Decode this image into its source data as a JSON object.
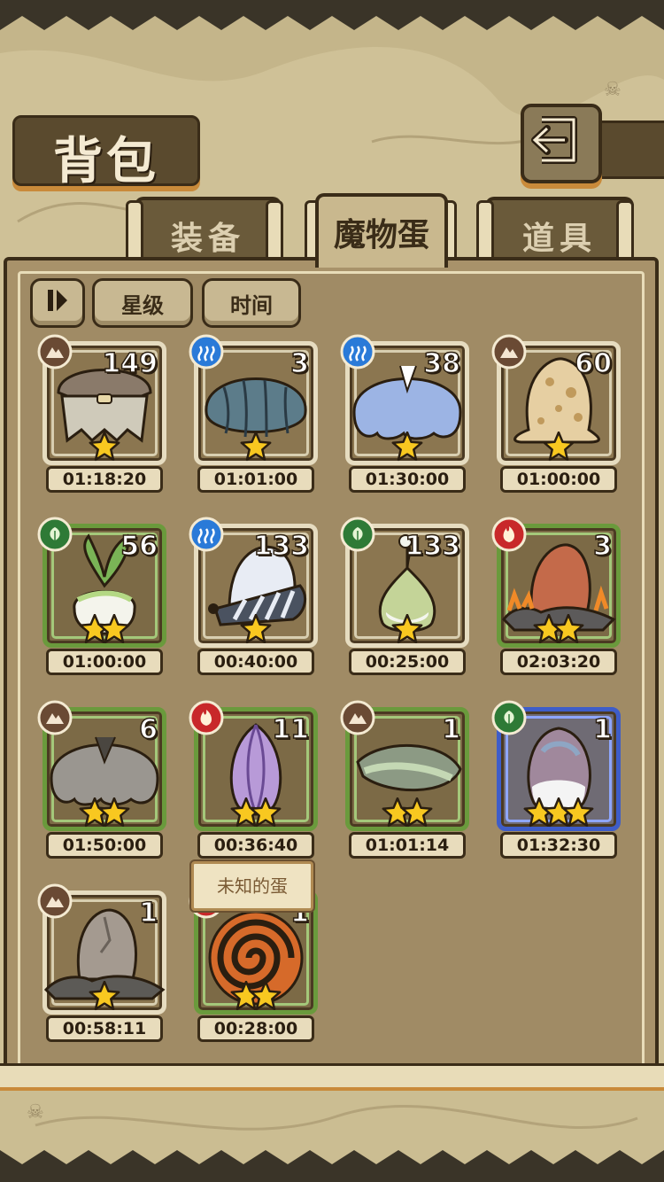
{
  "header": {
    "title": "背包",
    "back_icon": "return-arrow-icon"
  },
  "tabs": [
    {
      "label": "装备",
      "active": false
    },
    {
      "label": "魔物蛋",
      "active": true
    },
    {
      "label": "道具",
      "active": false
    }
  ],
  "sort": {
    "toggle_icon": "sort-toggle-icon",
    "star_label": "星级",
    "time_label": "时间"
  },
  "eggs": [
    {
      "count": "149",
      "element": "earth",
      "stars": 1,
      "time": "01:18:20",
      "frame": "beige",
      "art": "metal-clam"
    },
    {
      "count": "3",
      "element": "water",
      "stars": 1,
      "time": "01:01:00",
      "frame": "beige",
      "art": "blue-shell"
    },
    {
      "count": "38",
      "element": "water",
      "stars": 1,
      "time": "01:30:00",
      "frame": "beige",
      "art": "blue-blob"
    },
    {
      "count": "60",
      "element": "earth",
      "stars": 1,
      "time": "01:00:00",
      "frame": "beige",
      "art": "spotted-egg"
    },
    {
      "count": "56",
      "element": "wood",
      "stars": 2,
      "time": "01:00:00",
      "frame": "green",
      "art": "turnip"
    },
    {
      "count": "133",
      "element": "water",
      "stars": 1,
      "time": "00:40:00",
      "frame": "beige",
      "art": "striped-egg"
    },
    {
      "count": "133",
      "element": "wood",
      "stars": 1,
      "time": "00:25:00",
      "frame": "beige",
      "art": "bulb"
    },
    {
      "count": "3",
      "element": "fire",
      "stars": 2,
      "time": "02:03:20",
      "frame": "green",
      "art": "fire-egg"
    },
    {
      "count": "6",
      "element": "earth",
      "stars": 2,
      "time": "01:50:00",
      "frame": "green",
      "art": "grey-blob"
    },
    {
      "count": "11",
      "element": "fire",
      "stars": 2,
      "time": "00:36:40",
      "frame": "green",
      "art": "purple-bud"
    },
    {
      "count": "1",
      "element": "earth",
      "stars": 2,
      "time": "01:01:14",
      "frame": "green",
      "art": "green-pod"
    },
    {
      "count": "1",
      "element": "wood",
      "stars": 3,
      "time": "01:32:30",
      "frame": "blue",
      "art": "pearl-egg"
    },
    {
      "count": "1",
      "element": "earth",
      "stars": 1,
      "time": "00:58:11",
      "frame": "beige",
      "art": "rock-egg"
    },
    {
      "count": "1",
      "element": "fire",
      "stars": 2,
      "time": "00:28:00",
      "frame": "green",
      "art": "swirl-egg"
    }
  ],
  "tooltip": {
    "text": "未知的蛋"
  },
  "colors": {
    "earth": "#6a4a34",
    "water": "#2a7ad8",
    "wood": "#2e7a36",
    "fire": "#c8282a",
    "star": "#f8c820"
  }
}
